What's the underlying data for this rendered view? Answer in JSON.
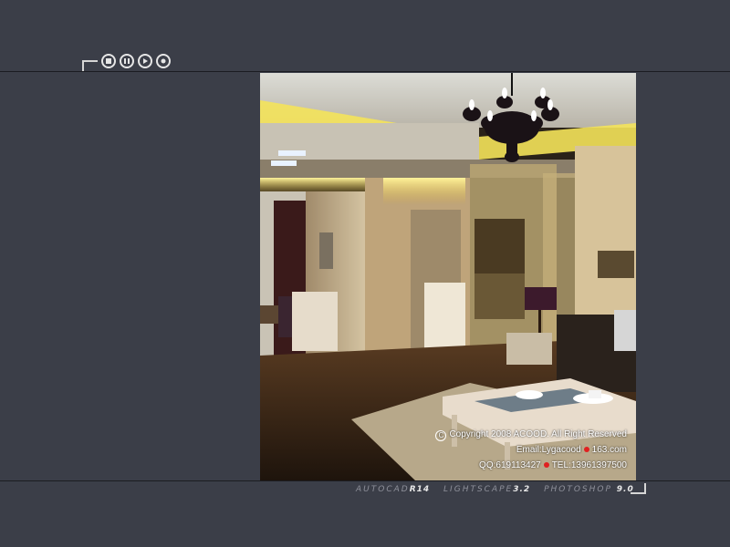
{
  "player": {
    "controls": [
      {
        "name": "stop-button",
        "icon": "stop-icon"
      },
      {
        "name": "pause-button",
        "icon": "pause-icon"
      },
      {
        "name": "play-button",
        "icon": "play-icon"
      },
      {
        "name": "record-button",
        "icon": "record-icon"
      }
    ]
  },
  "photo": {
    "copyright_line": "Copyright 2008 ACOOD.  All  Right  Reserved",
    "email_line": "Email:Lygacood",
    "email_domain": "163.com",
    "qq_line": "QQ:619113427",
    "tel_line": "TEL:13961397500"
  },
  "software": {
    "autocad_name": "AUTOCAD",
    "autocad_version": "R14",
    "lightscape_name": "LIGHTSCAPE",
    "lightscape_version": "3.2",
    "photoshop_name": "PHOTOSHOP",
    "photoshop_version": "9.0"
  },
  "colors": {
    "background": "#3b3e48",
    "control_stroke": "#e6e6e6",
    "accent_light": "#f5e050"
  }
}
